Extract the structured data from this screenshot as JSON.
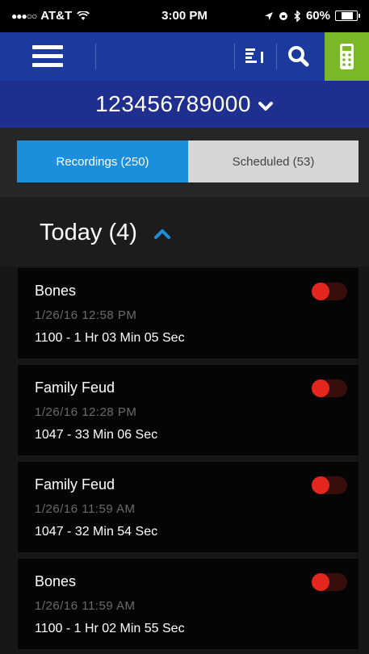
{
  "status_bar": {
    "signal": "●●●○○",
    "carrier": "AT&T",
    "time": "3:00 PM",
    "battery_text": "60%",
    "battery_level": 0.6
  },
  "account": {
    "number": "123456789000"
  },
  "tabs": [
    {
      "label": "Recordings (250)",
      "selected": true
    },
    {
      "label": "Scheduled (53)",
      "selected": false
    }
  ],
  "section": {
    "title": "Today (4)",
    "expanded": true
  },
  "recordings": [
    {
      "title": "Bones",
      "date": "1/26/16 12:58 PM",
      "detail": "1100 - 1 Hr 03 Min 05 Sec"
    },
    {
      "title": "Family Feud",
      "date": "1/26/16 12:28 PM",
      "detail": "1047 - 33 Min 06 Sec"
    },
    {
      "title": "Family Feud",
      "date": "1/26/16 11:59 AM",
      "detail": "1047 - 32 Min 54 Sec"
    },
    {
      "title": "Bones",
      "date": "1/26/16 11:59 AM",
      "detail": "1100 - 1 Hr 02 Min 55 Sec"
    }
  ],
  "icons": {
    "menu": "hamburger-icon",
    "sort": "sort-icon",
    "search": "search-icon",
    "remote": "remote-icon",
    "account_dropdown": "chevron-down-icon",
    "section_toggle": "chevron-up-icon"
  },
  "colors": {
    "nav_bg": "#1a3a9e",
    "account_bg": "#1e2f8f",
    "remote_bg": "#7ab827",
    "tab_selected": "#1b8fdc",
    "tab_unselected": "#d6d6d6",
    "accent_chevron": "#1b8fdc",
    "recording_red": "#e5261f"
  }
}
